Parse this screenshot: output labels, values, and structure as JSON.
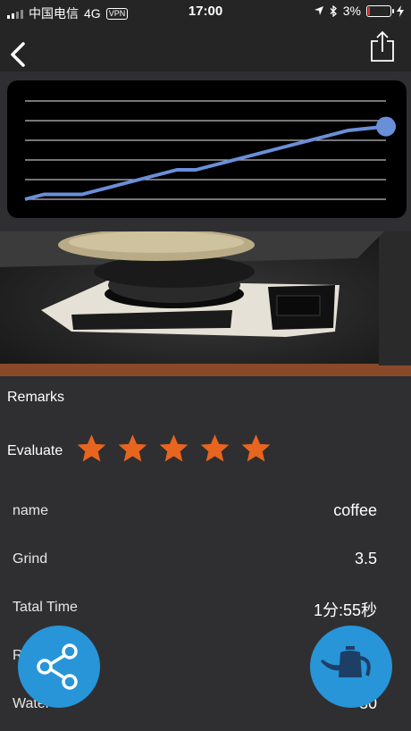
{
  "status": {
    "carrier": "中国电信",
    "network": "4G",
    "vpn": "VPN",
    "time": "17:00",
    "battery": "3%",
    "battery_level": 0.03
  },
  "chart_data": {
    "type": "line",
    "y_gridlines": 6,
    "series": [
      {
        "values": [
          0,
          0.05,
          0.05,
          0.05,
          0.1,
          0.15,
          0.2,
          0.25,
          0.3,
          0.3,
          0.35,
          0.4,
          0.45,
          0.5,
          0.55,
          0.6,
          0.65,
          0.7,
          0.72,
          0.74
        ],
        "color": "#6a8fd9"
      }
    ],
    "end_marker": true,
    "background": "#000000",
    "grid": true
  },
  "remarks_label": "Remarks",
  "evaluate": {
    "label": "Evaluate",
    "rating": 5,
    "max": 5,
    "star_color": "#e8651f"
  },
  "details": [
    {
      "label": "name",
      "value": "coffee"
    },
    {
      "label": "Grind",
      "value": "3.5"
    },
    {
      "label": "Tatal Time",
      "value": "1分:55秒"
    },
    {
      "label": "Ratio",
      "value": ""
    },
    {
      "label": "Water",
      "value": "30"
    }
  ],
  "icons": {
    "back": "chevron-left-icon",
    "share_top": "share-icon",
    "fab_left": "share-nodes-icon",
    "fab_right": "kettle-icon"
  },
  "colors": {
    "fab": "#2795d8",
    "background": "#2f2f31",
    "bar": "#252526"
  }
}
